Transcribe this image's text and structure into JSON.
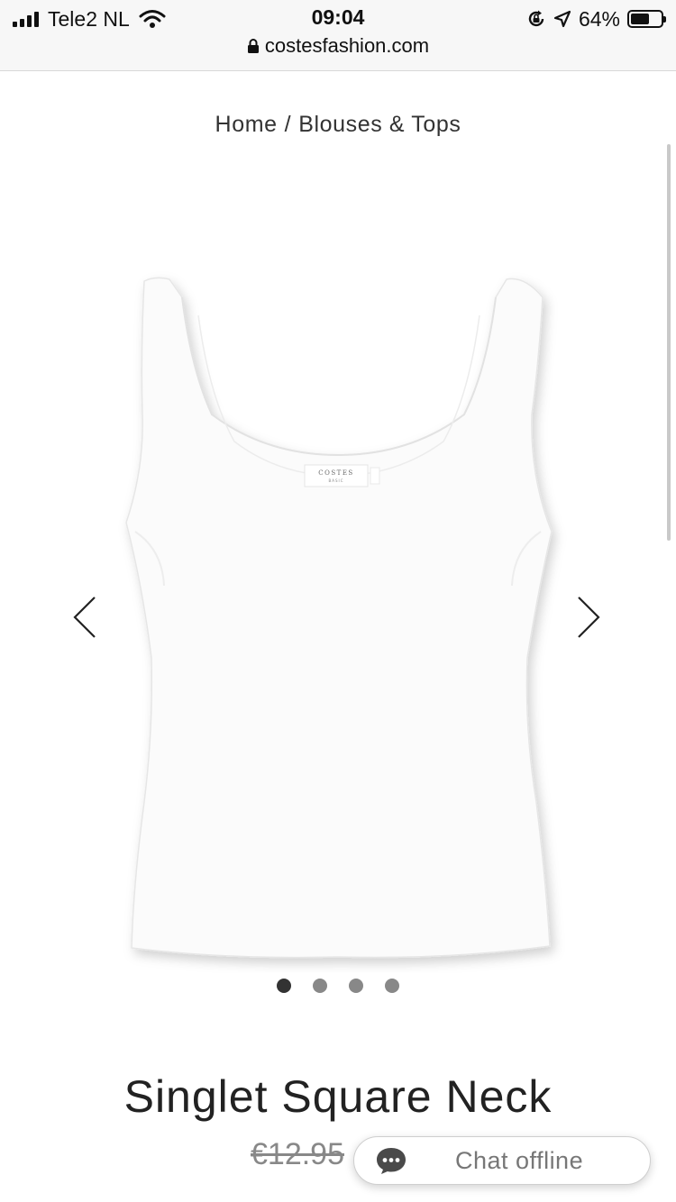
{
  "status_bar": {
    "carrier": "Tele2 NL",
    "time": "09:04",
    "battery_percent": "64%",
    "battery_level": 0.64,
    "url": "costesfashion.com"
  },
  "breadcrumb": {
    "home": "Home",
    "separator": "/",
    "category": "Blouses & Tops"
  },
  "product": {
    "label_brand": "COSTES",
    "label_sub": "BASIC",
    "title": "Singlet Square Neck",
    "old_price": "€12.95"
  },
  "gallery": {
    "image_count": 4,
    "active_index": 0
  },
  "chat": {
    "label": "Chat offline"
  }
}
